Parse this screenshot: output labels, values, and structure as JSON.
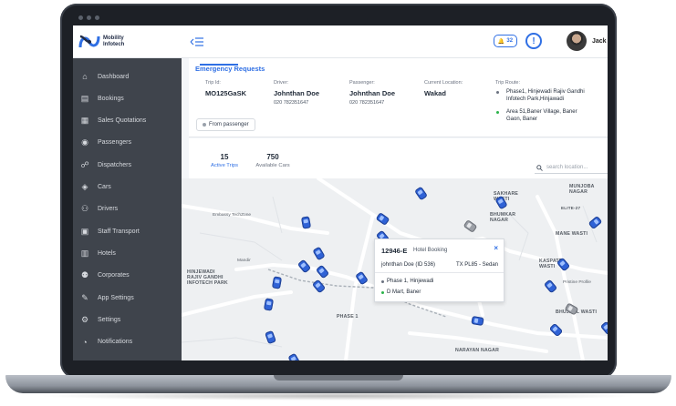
{
  "header": {
    "brand_line1": "Mobility",
    "brand_line2": "Infotech",
    "notification_count": "32",
    "alert_symbol": "!",
    "user_name": "Jack"
  },
  "sidebar": {
    "items": [
      {
        "label": "Dashboard",
        "icon": "home-icon"
      },
      {
        "label": "Bookings",
        "icon": "bookings-icon"
      },
      {
        "label": "Sales Quotations",
        "icon": "quotation-icon"
      },
      {
        "label": "Passengers",
        "icon": "passenger-icon"
      },
      {
        "label": "Dispatchers",
        "icon": "dispatcher-icon"
      },
      {
        "label": "Cars",
        "icon": "car-icon"
      },
      {
        "label": "Drivers",
        "icon": "driver-icon"
      },
      {
        "label": "Staff Transport",
        "icon": "staff-icon"
      },
      {
        "label": "Hotels",
        "icon": "hotel-icon"
      },
      {
        "label": "Corporates",
        "icon": "corporate-icon"
      },
      {
        "label": "App Settings",
        "icon": "app-settings-icon"
      },
      {
        "label": "Settings",
        "icon": "gear-icon"
      },
      {
        "label": "Notifications",
        "icon": "bell-icon"
      }
    ]
  },
  "emergency": {
    "title": "Emergency Requests",
    "trip_id_label": "Trip Id:",
    "trip_id": "MO125GaSK",
    "driver_label": "Driver:",
    "driver_name": "Johnthan Doe",
    "driver_phone": "020 782351647",
    "passenger_label": "Passenger:",
    "passenger_name": "Johnthan Doe",
    "passenger_phone": "020 782351647",
    "location_label": "Current Location:",
    "location": "Wakad",
    "route_label": "Trip Route:",
    "route_from_1": "Phase1, Hinjewadi Rajiv Gandhi",
    "route_from_2": "Infotech Park,Hinjawadi",
    "route_to_1": "Area 51,Baner Village, Baner",
    "route_to_2": "Gaon, Baner",
    "chip": "From passenger"
  },
  "stats": {
    "active_trips_value": "15",
    "active_trips_label": "Active Trips",
    "available_cars_value": "750",
    "available_cars_label": "Available Cars",
    "search_placeholder": "search location..."
  },
  "map": {
    "labels": {
      "sakhare_wasti": "SAKHARE\nWASTI",
      "munjoba_nagar": "MUNJOBA\nNAGAR",
      "bhumkar_nagar": "BHUMKAR\nNAGAR",
      "elite": "ELITE-27",
      "mane_wasti": "MANE WASTI",
      "kaspate_wasti": "KASPATE\nWASTI",
      "hinjewadi": "HINJEWADI\nRAJIV GANDHI\nINFOTECH PARK",
      "phase1": "PHASE 1",
      "bhujbal_wasti": "BHUJBAL WASTI",
      "narayan_nagar": "NARAYAN NAGAR",
      "embassy": "Embassy TechZone",
      "mandir": "Mandir",
      "pristine": "Pristine Profile"
    },
    "popup": {
      "id": "12946-E",
      "kind": "Hotel Booking",
      "close": "×",
      "driver": "johnthan Doe (ID 536)",
      "plate": "TX PL85 - Sedan",
      "stop1": "Phase 1, Hinjewadi",
      "stop2": "D Mart, Baner"
    }
  },
  "colors": {
    "accent": "#2f6fe4",
    "sidebar": "#3f444c",
    "route_start": "#6b7280",
    "route_end": "#2bb34a"
  }
}
